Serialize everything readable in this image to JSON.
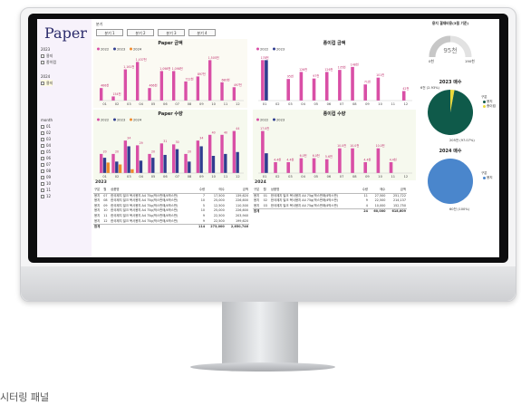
{
  "dashboard": {
    "title": "Paper",
    "quarter_label": "분기",
    "quarters": [
      "분기 1",
      "분기 2",
      "분기 3",
      "분기 4"
    ],
    "filters": {
      "year_2023": "2023",
      "year_2023_items": [
        "용지",
        "종이컵"
      ],
      "year_2024": "2024",
      "year_2024_items": [
        "용지"
      ],
      "month_label": "month",
      "months": [
        "01",
        "02",
        "03",
        "04",
        "05",
        "06",
        "07",
        "08",
        "09",
        "10",
        "11",
        "12"
      ]
    },
    "gauge": {
      "title": "용지 결재비용(3월 기준)",
      "value": "95천",
      "min": "0천",
      "max": "190천",
      "fraction": 0.5
    },
    "colors": {
      "y2022": "#d94fa6",
      "y2023": "#2f3d8f",
      "y2024": "#f08a2a",
      "pie_green": "#0f5a4a",
      "pie_yellow": "#e8d93a",
      "pie_blue": "#4a86cc"
    },
    "pie_2023": {
      "title": "2023 매수",
      "legend_title": "구분",
      "items": [
        "용지",
        "종이컵"
      ],
      "label_small": "6천 (2.93%)",
      "label_big": "205천 (97.07%)",
      "fraction_small": 0.0293
    },
    "pie_2024": {
      "title": "2024 매수",
      "legend_title": "구분",
      "items": [
        "용지"
      ],
      "label": "60천 (100%)"
    },
    "table_2023": {
      "title": "2023",
      "headers": [
        "구분",
        "월",
        "상품명",
        "수량",
        "매수",
        "금액"
      ],
      "rows": [
        [
          "용지",
          "07",
          "한국제지 밀크 복사용지 A4 75g(박스판매/4박스판)",
          "7",
          "17,500",
          "139,620"
        ],
        [
          "용지",
          "08",
          "한국제지 밀크 복사용지 A4 75g(박스판매/4박스판)",
          "10",
          "25,000",
          "226,600"
        ],
        [
          "용지",
          "09",
          "한국제지 밀크 복사용지 A4 75g(박스판매/4박스판)",
          "5",
          "12,500",
          "110,500"
        ],
        [
          "용지",
          "10",
          "한국제지 밀크 복사용지 A4 75g(박스판매/4박스판)",
          "10",
          "25,000",
          "226,600"
        ],
        [
          "용지",
          "11",
          "한국제지 밀크 복사용지 A4 75g(박스판매/4박스판)",
          "9",
          "22,500",
          "203,940"
        ],
        [
          "용지",
          "12",
          "한국제지 밀크 복사용지 A4 75g(박스판매/4박스판)",
          "9",
          "22,500",
          "199,620"
        ]
      ],
      "total": [
        "합계",
        "",
        "",
        "114",
        "273,000",
        "2,650,746"
      ]
    },
    "table_2024": {
      "title": "2024",
      "headers": [
        "구분",
        "월",
        "상품명",
        "수량",
        "매수",
        "금액"
      ],
      "rows": [
        [
          "용지",
          "01",
          "한국제지 밀크 복사용지 A4 75g(박스판매/4박스판)",
          "11",
          "27,500",
          "251,722"
        ],
        [
          "용지",
          "02",
          "한국제지 밀크 복사용지 A4 75g(박스판매/4박스판)",
          "9",
          "22,500",
          "214,137"
        ],
        [
          "용지",
          "03",
          "한국제지 밀크 복사용지 A4 75g(박스판매/4박스판)",
          "4",
          "10,000",
          "152,750"
        ]
      ],
      "total": [
        "합계",
        "",
        "",
        "24",
        "60,000",
        "618,609"
      ]
    },
    "caption": "시터링 패널"
  },
  "chart_data": [
    {
      "type": "bar",
      "title": "Paper 금액",
      "categories": [
        "01",
        "02",
        "03",
        "04",
        "05",
        "06",
        "07",
        "08",
        "09",
        "10",
        "11",
        "12"
      ],
      "series": [
        {
          "name": "2022",
          "values": [
            466,
            154,
            1161,
            1437,
            466,
            1098,
            1098,
            712,
            897,
            1505,
            680,
            497
          ]
        },
        {
          "name": "2023",
          "values": [
            0,
            0,
            0,
            0,
            0,
            0,
            0,
            0,
            0,
            0,
            0,
            0
          ]
        },
        {
          "name": "2024",
          "values": [
            0,
            0,
            0,
            0,
            0,
            0,
            0,
            0,
            0,
            0,
            0,
            0
          ]
        }
      ],
      "data_labels": [
        "466천",
        "154천",
        "1,161천",
        "1,437천",
        "466천",
        "1,098천",
        "1,098천",
        "712천",
        "897천",
        "1,505천",
        "680천",
        "497천"
      ]
    },
    {
      "type": "bar",
      "title": "종이컵 금액",
      "categories": [
        "01",
        "02",
        "03",
        "04",
        "05",
        "06",
        "07",
        "08",
        "09",
        "10",
        "11",
        "12"
      ],
      "series": [
        {
          "name": "2022",
          "values": [
            178,
            0,
            95,
            126,
            97,
            126,
            135,
            148,
            71,
            101,
            0,
            42
          ]
        },
        {
          "name": "2023",
          "values": [
            178,
            0,
            0,
            0,
            0,
            0,
            0,
            0,
            0,
            0,
            0,
            0
          ]
        }
      ],
      "data_labels": [
        "178천",
        "",
        "95천",
        "126천",
        "97천",
        "126천",
        "135천",
        "148천",
        "71천",
        "101천",
        "",
        "42천"
      ]
    },
    {
      "type": "bar",
      "title": "Paper 수량",
      "categories": [
        "01",
        "02",
        "03",
        "04",
        "05",
        "06",
        "07",
        "08",
        "09",
        "10",
        "11",
        "12"
      ],
      "series": [
        {
          "name": "2022",
          "values": [
            20,
            20,
            34,
            29,
            20,
            31,
            30,
            20,
            34,
            40,
            40,
            44
          ]
        },
        {
          "name": "2023",
          "values": [
            16,
            12,
            28,
            13,
            16,
            19,
            25,
            12,
            28,
            18,
            20,
            22
          ]
        },
        {
          "name": "2024",
          "values": [
            11,
            9,
            4,
            0,
            0,
            0,
            0,
            0,
            0,
            0,
            0,
            0
          ]
        }
      ],
      "data_labels": [
        "20",
        "20",
        "34",
        "29",
        "20",
        "31",
        "30",
        "20",
        "34",
        "40",
        "40",
        "44"
      ]
    },
    {
      "type": "bar",
      "title": "종이컵 수량",
      "categories": [
        "01",
        "02",
        "03",
        "04",
        "05",
        "06",
        "07",
        "08",
        "09",
        "10",
        "11",
        "12"
      ],
      "series": [
        {
          "name": "2022",
          "values": [
            17,
            4.4,
            4.4,
            6.0,
            6.0,
            5.6,
            10,
            10,
            4.4,
            10,
            4.4,
            0
          ]
        },
        {
          "name": "2023",
          "values": [
            8,
            0,
            0,
            0,
            0,
            0,
            0,
            0,
            0,
            0,
            0,
            0
          ]
        }
      ],
      "data_labels": [
        "17.0천",
        "4.4천",
        "4.4천",
        "6.0천",
        "6.0천",
        "5.6천",
        "10.0천",
        "10.0천",
        "4.4천",
        "10.0천",
        "4.4천",
        ""
      ]
    }
  ]
}
